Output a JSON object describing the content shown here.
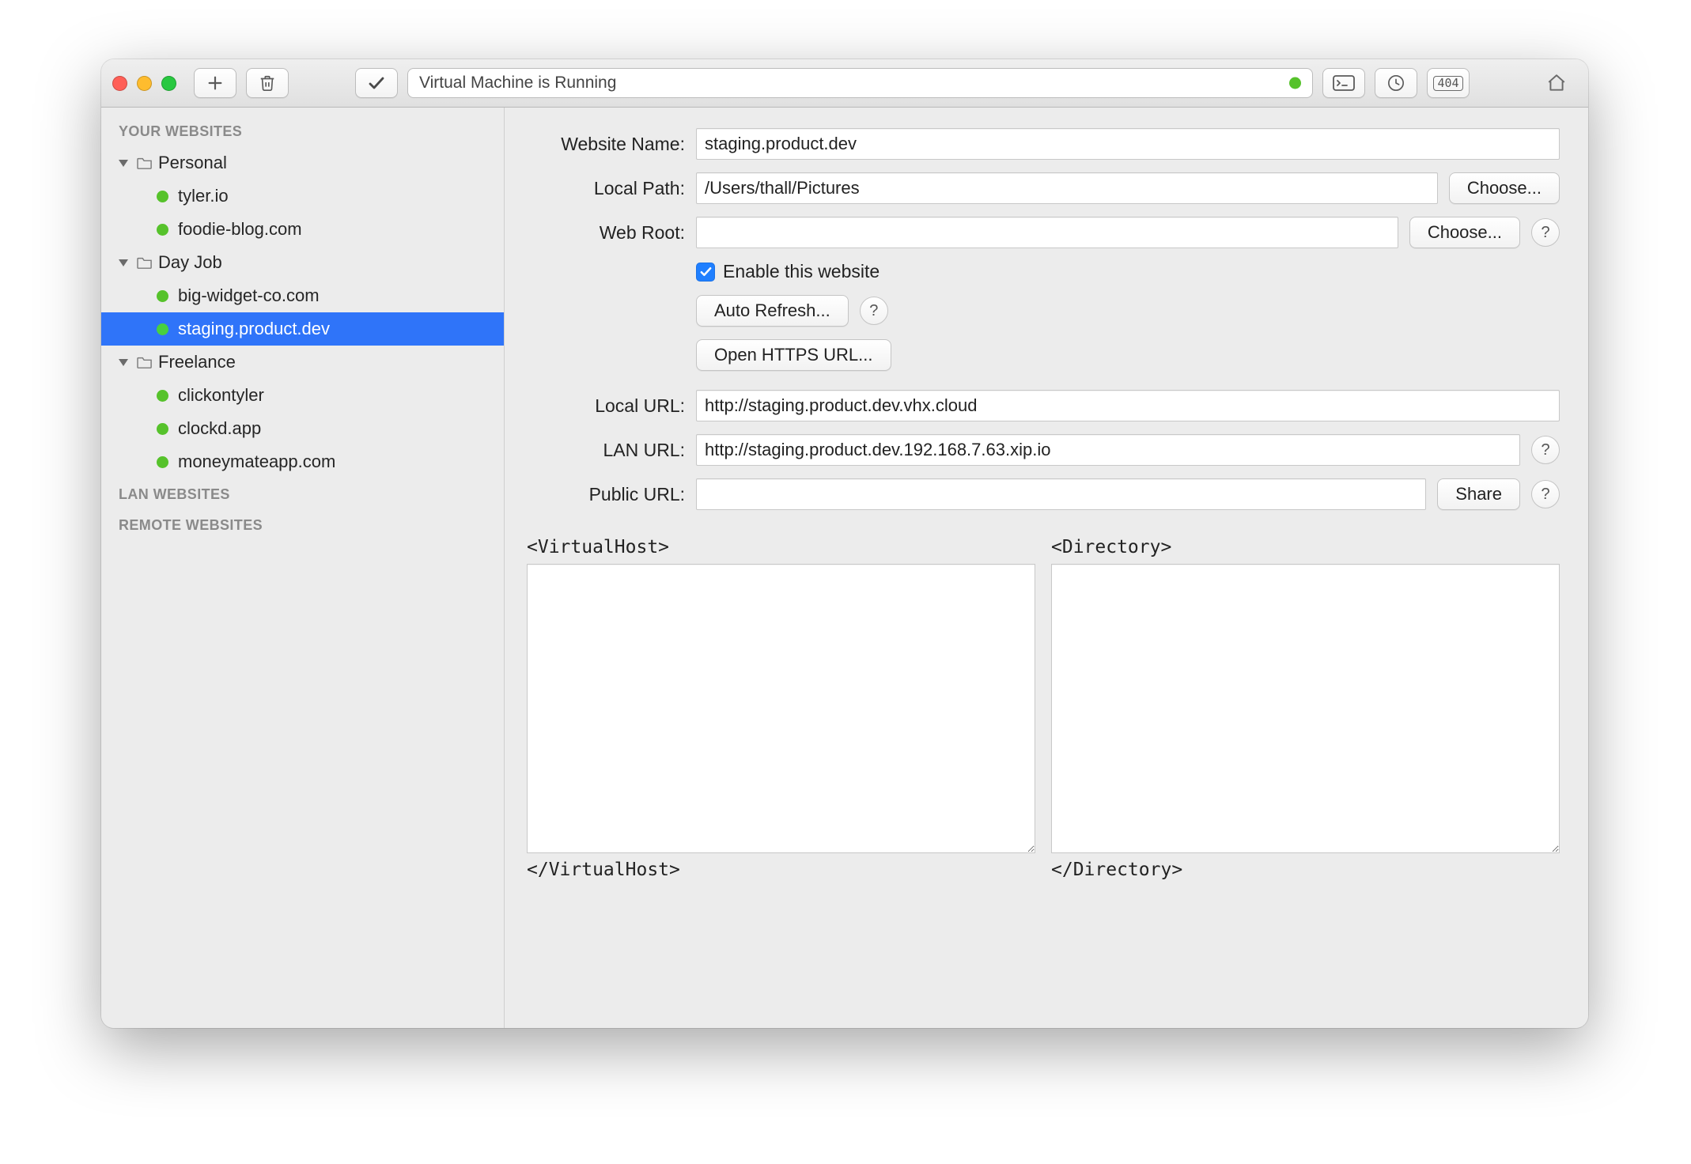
{
  "toolbar": {
    "status_text": "Virtual Machine is Running",
    "status_dot_color": "#56c22b"
  },
  "sidebar": {
    "sections": {
      "your": "YOUR WEBSITES",
      "lan": "LAN WEBSITES",
      "remote": "REMOTE WEBSITES"
    },
    "groups": [
      {
        "name": "Personal",
        "items": [
          {
            "label": "tyler.io",
            "status": "green"
          },
          {
            "label": "foodie-blog.com",
            "status": "green"
          }
        ]
      },
      {
        "name": "Day Job",
        "items": [
          {
            "label": "big-widget-co.com",
            "status": "green"
          },
          {
            "label": "staging.product.dev",
            "status": "green",
            "selected": true
          }
        ]
      },
      {
        "name": "Freelance",
        "items": [
          {
            "label": "clickontyler",
            "status": "green"
          },
          {
            "label": "clockd.app",
            "status": "green"
          },
          {
            "label": "moneymateapp.com",
            "status": "green"
          }
        ]
      }
    ]
  },
  "form": {
    "labels": {
      "website_name": "Website Name:",
      "local_path": "Local Path:",
      "web_root": "Web Root:",
      "local_url": "Local URL:",
      "lan_url": "LAN URL:",
      "public_url": "Public URL:"
    },
    "buttons": {
      "choose": "Choose...",
      "auto_refresh": "Auto Refresh...",
      "open_https": "Open HTTPS URL...",
      "share": "Share"
    },
    "checkbox": {
      "enable_label": "Enable this website",
      "enable_checked": true
    },
    "values": {
      "website_name": "staging.product.dev",
      "local_path": "/Users/thall/Pictures",
      "web_root": "",
      "local_url": "http://staging.product.dev.vhx.cloud",
      "lan_url": "http://staging.product.dev.192.168.7.63.xip.io",
      "public_url": ""
    },
    "config": {
      "vhost_open": "<VirtualHost>",
      "vhost_close": "</VirtualHost>",
      "dir_open": "<Directory>",
      "dir_close": "</Directory>",
      "vhost_body": "",
      "dir_body": ""
    }
  },
  "help_glyph": "?"
}
